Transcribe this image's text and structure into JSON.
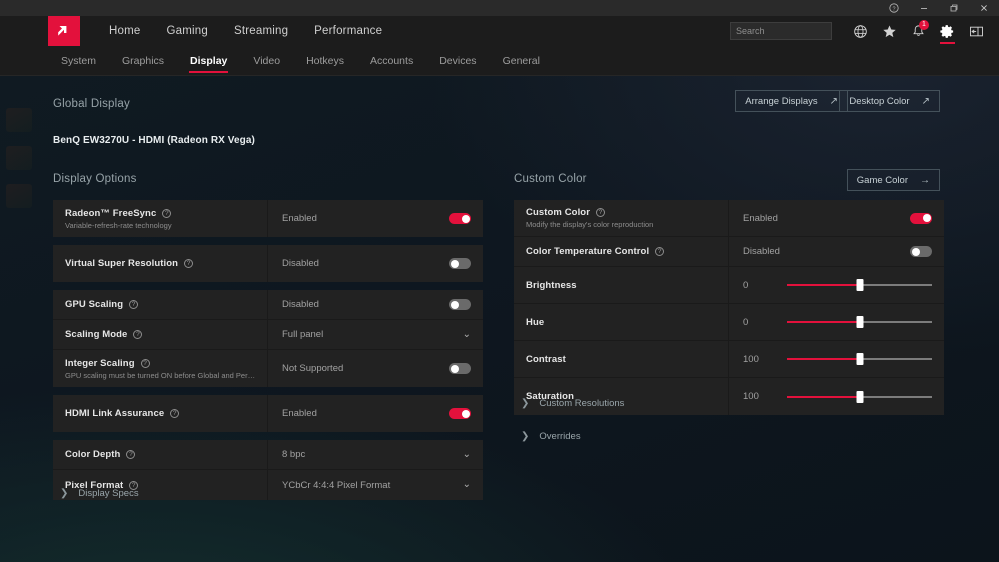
{
  "titlebar": {
    "buttons": [
      {
        "name": "help-icon",
        "label": "?"
      },
      {
        "name": "minimize-button",
        "label": "–"
      },
      {
        "name": "restore-button",
        "label": "❐"
      },
      {
        "name": "close-button",
        "label": "✕"
      }
    ]
  },
  "mainnav": {
    "logo_alt": "AMD Radeon Software",
    "links": [
      {
        "label": "Home"
      },
      {
        "label": "Gaming"
      },
      {
        "label": "Streaming"
      },
      {
        "label": "Performance"
      }
    ],
    "search": {
      "placeholder": "Search",
      "value": ""
    },
    "icons": [
      {
        "name": "globe-icon",
        "badge": ""
      },
      {
        "name": "star-icon",
        "badge": ""
      },
      {
        "name": "notifications-bell-icon",
        "badge": "1"
      },
      {
        "name": "settings-gear-icon",
        "badge": "",
        "active": true
      },
      {
        "name": "side-panel-icon",
        "badge": ""
      }
    ]
  },
  "subnav": {
    "items": [
      {
        "label": "System",
        "active": false
      },
      {
        "label": "Graphics",
        "active": false
      },
      {
        "label": "Display",
        "active": true
      },
      {
        "label": "Video",
        "active": false
      },
      {
        "label": "Hotkeys",
        "active": false
      },
      {
        "label": "Accounts",
        "active": false
      },
      {
        "label": "Devices",
        "active": false
      },
      {
        "label": "General",
        "active": false
      }
    ]
  },
  "content": {
    "global_display_title": "Global Display",
    "monitor_name": "BenQ EW3270U - HDMI (Radeon RX Vega)",
    "display_options_title": "Display Options",
    "custom_color_title": "Custom Color",
    "buttons": {
      "arrange_displays": {
        "label": "Arrange Displays",
        "arrow": "↗"
      },
      "desktop_color": {
        "label": "Desktop Color",
        "arrow": "↗"
      },
      "game_color": {
        "label": "Game Color",
        "arrow": "→"
      }
    },
    "display_options": [
      {
        "label": "Radeon™ FreeSync",
        "sublabel": "Variable-refresh-rate technology",
        "help": true,
        "value": "Enabled",
        "control": "toggle",
        "toggle_on": true
      },
      {
        "label": "Virtual Super Resolution",
        "sublabel": "",
        "help": true,
        "value": "Disabled",
        "control": "toggle",
        "toggle_on": false
      },
      {
        "label": "GPU Scaling",
        "sublabel": "",
        "help": true,
        "value": "Disabled",
        "control": "toggle",
        "toggle_on": false
      },
      {
        "label": "Scaling Mode",
        "sublabel": "",
        "help": true,
        "value": "Full panel",
        "control": "dropdown",
        "chevron": "⌄"
      },
      {
        "label": "Integer Scaling",
        "sublabel": "GPU scaling must be turned ON before Global and PerApp Intege…",
        "help": true,
        "value": "Not Supported",
        "control": "toggle",
        "toggle_on": false
      },
      {
        "label": "HDMI Link Assurance",
        "sublabel": "",
        "help": true,
        "value": "Enabled",
        "control": "toggle",
        "toggle_on": true
      },
      {
        "label": "Color Depth",
        "sublabel": "",
        "help": true,
        "value": "8 bpc",
        "control": "dropdown",
        "chevron": "⌄"
      },
      {
        "label": "Pixel Format",
        "sublabel": "",
        "help": true,
        "value": "YCbCr 4:4:4 Pixel Format",
        "control": "dropdown",
        "chevron": "⌄"
      }
    ],
    "custom_color": [
      {
        "label": "Custom Color",
        "sublabel": "Modify the display's color reproduction",
        "help": true,
        "value": "Enabled",
        "control": "toggle",
        "toggle_on": true
      },
      {
        "label": "Color Temperature Control",
        "sublabel": "",
        "help": true,
        "value": "Disabled",
        "control": "toggle",
        "toggle_on": false
      },
      {
        "label": "Brightness",
        "sublabel": "",
        "help": false,
        "value": "0",
        "control": "slider",
        "slider_percent": 50
      },
      {
        "label": "Hue",
        "sublabel": "",
        "help": false,
        "value": "0",
        "control": "slider",
        "slider_percent": 50
      },
      {
        "label": "Contrast",
        "sublabel": "",
        "help": false,
        "value": "100",
        "control": "slider",
        "slider_percent": 50
      },
      {
        "label": "Saturation",
        "sublabel": "",
        "help": false,
        "value": "100",
        "control": "slider",
        "slider_percent": 50
      }
    ],
    "expanders": {
      "display_specs": {
        "label": "Display Specs",
        "chevron": "❯"
      },
      "custom_resolutions": {
        "label": "Custom Resolutions",
        "chevron": "❯"
      },
      "overrides": {
        "label": "Overrides",
        "chevron": "❯"
      }
    }
  },
  "colors": {
    "accent": "#e3113c",
    "panel": "#222222",
    "nav": "#1c1c1c",
    "titlebar": "#2a2a2a"
  }
}
